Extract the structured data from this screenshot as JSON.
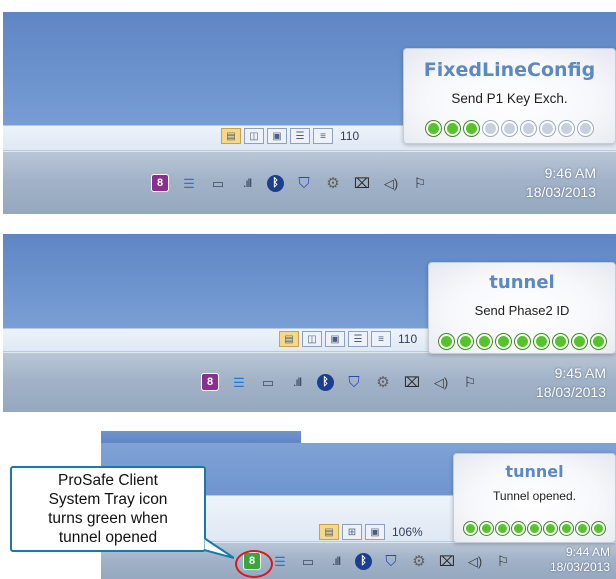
{
  "panels": [
    {
      "notification": {
        "title": "FixedLineConfig",
        "message": "Send P1 Key Exch.",
        "progress_dots_total": 9,
        "progress_dots_on": 3
      },
      "zoom_label": "110",
      "clock": {
        "time": "9:46 AM",
        "date": "18/03/2013"
      },
      "prosafe_icon_state": "purple"
    },
    {
      "notification": {
        "title": "tunnel",
        "message": "Send Phase2 ID",
        "progress_dots_total": 9,
        "progress_dots_on": 9
      },
      "zoom_label": "110",
      "clock": {
        "time": "9:45 AM",
        "date": "18/03/2013"
      },
      "prosafe_icon_state": "purple"
    },
    {
      "notification": {
        "title": "tunnel",
        "message": "Tunnel opened.",
        "progress_dots_total": 9,
        "progress_dots_on": 9
      },
      "zoom_label": "106%",
      "clock": {
        "time": "9:44 AM",
        "date": "18/03/2013"
      },
      "prosafe_icon_state": "green"
    }
  ],
  "callout": {
    "lines": [
      "ProSafe Client",
      "System Tray icon",
      "turns green when",
      "tunnel opened"
    ]
  },
  "tray_icons": [
    "prosafe-vpn-icon",
    "database-icon",
    "monitor-icon",
    "signal-bars-icon",
    "bluetooth-icon",
    "shield-icon",
    "gear-icon",
    "plug-icon",
    "speaker-icon",
    "flag-icon"
  ],
  "colors": {
    "accent_title": "#5c88c4",
    "dot_on": "#55c42b",
    "dot_off": "#c7d0df",
    "prosafe_purple": "#8a2f8f",
    "prosafe_green": "#3aa53a",
    "callout_border": "#1a7aa3",
    "highlight_ring": "#e0141c"
  }
}
